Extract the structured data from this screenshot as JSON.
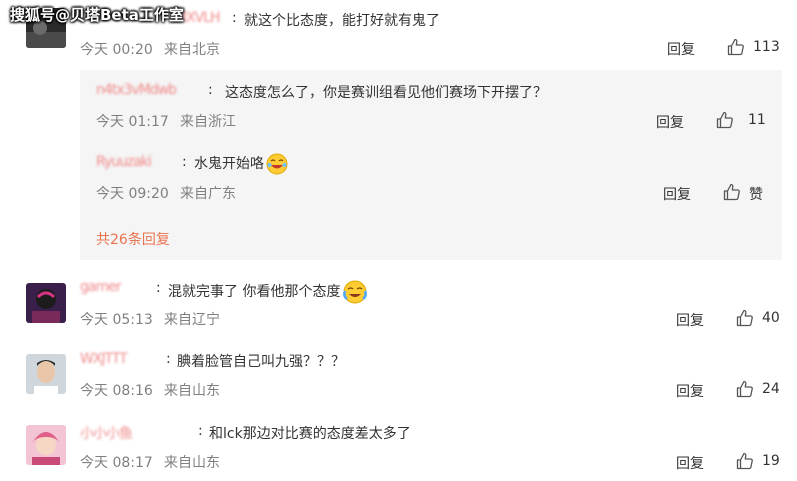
{
  "watermark": "搜狐号@贝塔Beta工作室",
  "comments": [
    {
      "username": "MXVLH",
      "text": "就这个比态度，能打好就有鬼了",
      "time": "今天 00:20",
      "location": "来自北京",
      "reply": "回复",
      "likes": "113"
    },
    {
      "username": "gamer",
      "text": "混就完事了 你看他那个态度",
      "time": "今天 05:13",
      "location": "来自辽宁",
      "reply": "回复",
      "likes": "40"
    },
    {
      "username": "WXJTTT",
      "text": "腆着脸管自己叫九强？？？",
      "time": "今天 08:16",
      "location": "来自山东",
      "reply": "回复",
      "likes": "24"
    },
    {
      "username": "小小小鱼",
      "text": "和lck那边对比赛的态度差太多了",
      "time": "今天 08:17",
      "location": "来自山东",
      "reply": "回复",
      "likes": "19"
    }
  ],
  "subreplies": [
    {
      "username": "n4tx3vMdwb",
      "text": "这态度怎么了，你是赛训组看见他们赛场下开摆了？",
      "time": "今天 01:17",
      "location": "来自浙江",
      "reply": "回复",
      "likes": "11"
    },
    {
      "username": "Ryuuzaki",
      "text": "水鬼开始咯",
      "time": "今天 09:20",
      "location": "来自广东",
      "reply": "回复",
      "likes": "赞"
    }
  ],
  "more_replies": "共26条回复",
  "icons": {
    "like": "thumbs-up-icon",
    "laugh_emoji": "laughing-emoji-icon",
    "cry_emoji": "tearful-emoji-icon"
  },
  "colors": {
    "accent": "#eb7350",
    "meta": "#808080",
    "subbox": "#f5f5f5"
  }
}
